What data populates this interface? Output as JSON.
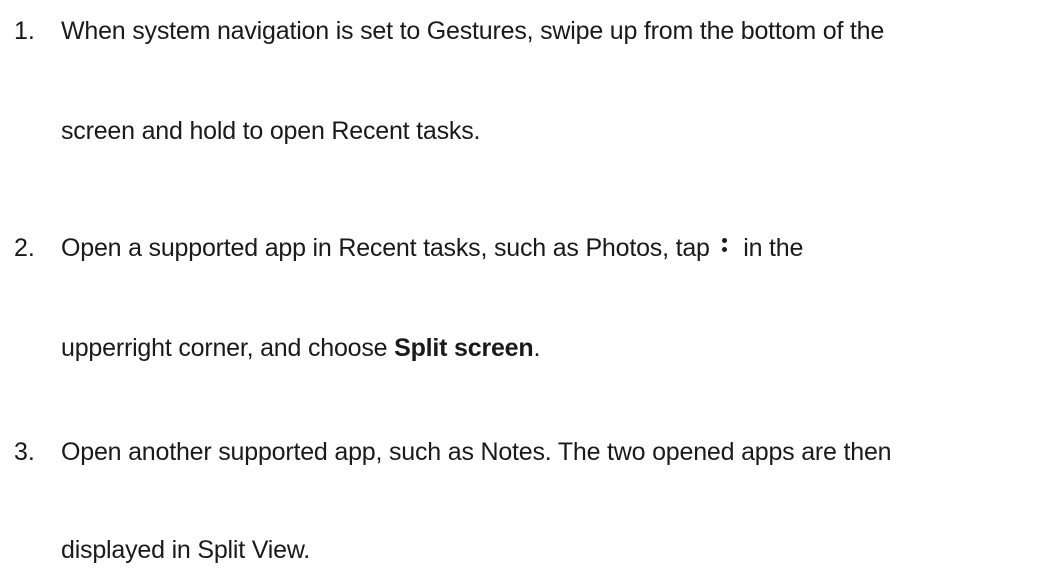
{
  "steps": [
    {
      "number": "1.",
      "line1": "When system navigation is set to Gestures, swipe up from the bottom of the",
      "line2": "screen and hold to open Recent tasks."
    },
    {
      "number": "2.",
      "line1_pre": "Open a supported app in Recent tasks, such as Photos, tap",
      "icon": "more-vertical-icon",
      "line1_post": "in the",
      "line2_pre": "upperright corner, and choose ",
      "line2_bold": "Split screen",
      "line2_post": "."
    },
    {
      "number": "3.",
      "line1": "Open another supported app, such as Notes. The two opened apps are then",
      "line2": "displayed in Split View."
    }
  ]
}
